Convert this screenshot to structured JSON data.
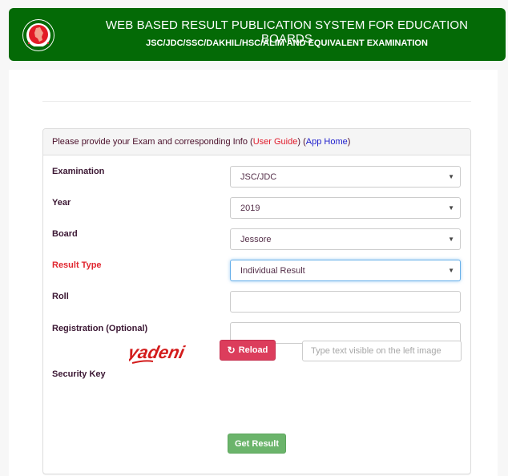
{
  "header": {
    "title": "WEB BASED RESULT PUBLICATION SYSTEM FOR EDUCATION BOARDS",
    "subtitle": "JSC/JDC/SSC/DAKHIL/HSC/ALIM AND EQUIVALENT EXAMINATION",
    "logo_icon": "government-seal-icon"
  },
  "panel": {
    "heading_text": "Please provide your Exam and corresponding Info ",
    "user_guide_link": "User Guide",
    "app_home_link": "App Home",
    "paren_open": "(",
    "paren_close": ")",
    "paren_between": ") (",
    "paren_end": ")"
  },
  "form": {
    "examination": {
      "label": "Examination",
      "value": "JSC/JDC"
    },
    "year": {
      "label": "Year",
      "value": "2019"
    },
    "board": {
      "label": "Board",
      "value": "Jessore"
    },
    "result_type": {
      "label": "Result Type",
      "value": "Individual Result"
    },
    "roll": {
      "label": "Roll",
      "value": ""
    },
    "registration": {
      "label": "Registration (Optional)",
      "value": ""
    },
    "security_key": {
      "label": "Security Key",
      "captcha_text": "yadeni",
      "reload_label": "Reload",
      "reload_icon": "refresh-icon",
      "input_placeholder": "Type text visible on the left image"
    },
    "submit_label": "Get Result"
  },
  "colors": {
    "header_bg": "#046a06",
    "label_highlight": "#e0262f",
    "reload_bg": "#dc3d5c",
    "submit_bg": "#6bb46b",
    "user_guide_link": "#e01b2b",
    "app_home_link": "#1d1dcc"
  }
}
